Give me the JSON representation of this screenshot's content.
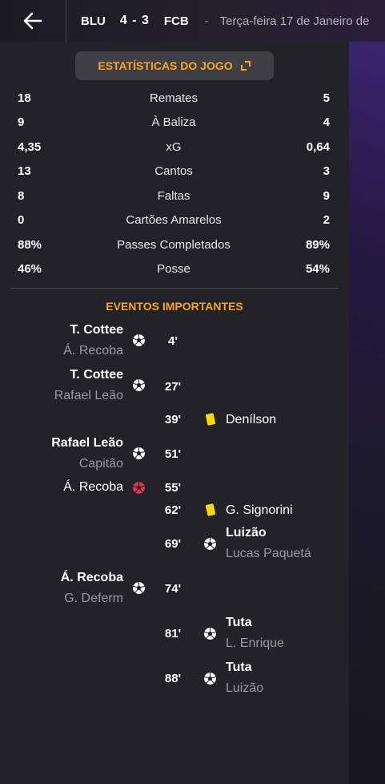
{
  "header": {
    "home_team": "BLU",
    "score": "4 - 3",
    "away_team": "FCB",
    "separator": "-",
    "date": "Terça-feira 17 de Janeiro de"
  },
  "stats": {
    "title": "ESTATÍSTICAS DO JOGO",
    "rows": [
      {
        "home": "18",
        "label": "Remates",
        "away": "5"
      },
      {
        "home": "9",
        "label": "À Baliza",
        "away": "4"
      },
      {
        "home": "4,35",
        "label": "xG",
        "away": "0,64"
      },
      {
        "home": "13",
        "label": "Cantos",
        "away": "3"
      },
      {
        "home": "8",
        "label": "Faltas",
        "away": "9"
      },
      {
        "home": "0",
        "label": "Cartões Amarelos",
        "away": "2"
      },
      {
        "home": "88%",
        "label": "Passes Completados",
        "away": "89%"
      },
      {
        "home": "46%",
        "label": "Posse",
        "away": "54%"
      }
    ]
  },
  "events": {
    "title": "EVENTOS IMPORTANTES",
    "items": [
      {
        "minute": "4'",
        "side": "home",
        "type": "goal",
        "player": "T. Cottee",
        "assist": "Á. Recoba"
      },
      {
        "minute": "27'",
        "side": "home",
        "type": "goal",
        "player": "T. Cottee",
        "assist": "Rafael Leão"
      },
      {
        "minute": "39'",
        "side": "away",
        "type": "yellow-card",
        "player": "Denílson"
      },
      {
        "minute": "51'",
        "side": "home",
        "type": "goal",
        "player": "Rafael Leão",
        "assist": "Capitão"
      },
      {
        "minute": "55'",
        "side": "home",
        "type": "missed-penalty",
        "player": "Á. Recoba"
      },
      {
        "minute": "62'",
        "side": "away",
        "type": "yellow-card",
        "player": "G. Signorini"
      },
      {
        "minute": "69'",
        "side": "away",
        "type": "goal",
        "player": "Luizão",
        "assist": "Lucas Paquetá"
      },
      {
        "minute": "74'",
        "side": "home",
        "type": "goal",
        "player": "Á. Recoba",
        "assist": "G. Deferm"
      },
      {
        "minute": "81'",
        "side": "away",
        "type": "goal",
        "player": "Tuta",
        "assist": "L. Enrique"
      },
      {
        "minute": "88'",
        "side": "away",
        "type": "goal",
        "player": "Tuta",
        "assist": "Luizão"
      }
    ]
  },
  "colors": {
    "accent": "#f5a623",
    "yellow_card": "#f5d90a",
    "missed": "#e0364a"
  }
}
